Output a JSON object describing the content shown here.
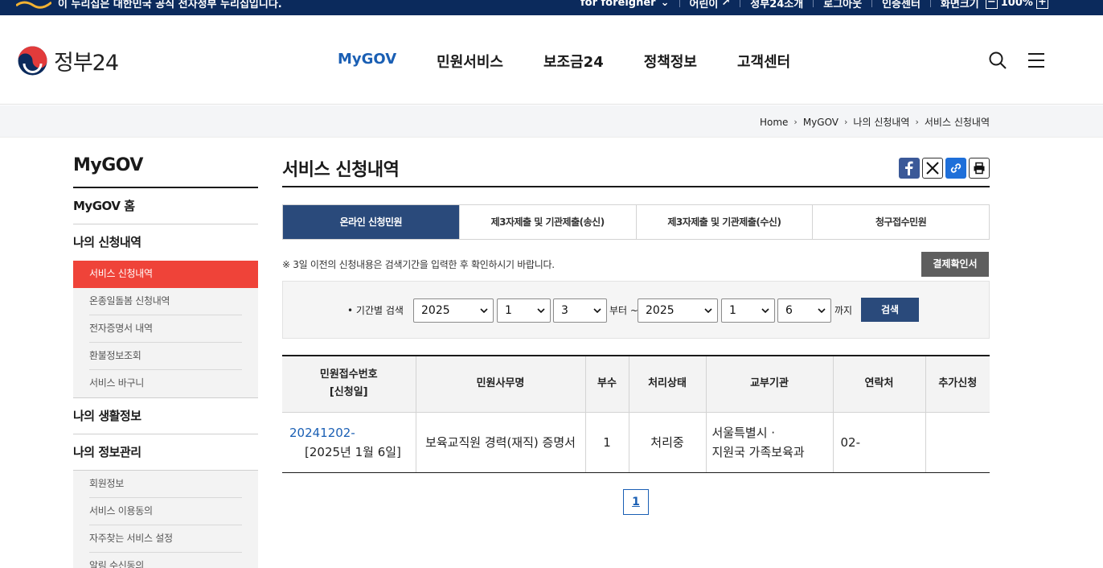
{
  "topbar": {
    "notice": "이 누리집은 대한민국 공식 전자정부 누리집입니다.",
    "links": [
      "for foreigner",
      "어린이",
      "정부24소개",
      "로그아웃",
      "인증센터",
      "화면크기"
    ],
    "zoom_minus": "−",
    "zoom_value": "100%",
    "zoom_plus": "+"
  },
  "header": {
    "logo_text": "정부24",
    "nav": [
      "MyGOV",
      "민원서비스",
      "보조금24",
      "정책정보",
      "고객센터"
    ],
    "active_nav": "MyGOV"
  },
  "breadcrumb": [
    "Home",
    "MyGOV",
    "나의 신청내역",
    "서비스 신청내역"
  ],
  "sidebar": {
    "title": "MyGOV",
    "groups": [
      {
        "label": "MyGOV 홈"
      },
      {
        "label": "나의 신청내역",
        "items": [
          "서비스 신청내역",
          "온종일돌봄 신청내역",
          "전자증명서 내역",
          "환불정보조회",
          "서비스 바구니"
        ]
      },
      {
        "label": "나의 생활정보"
      },
      {
        "label": "나의 정보관리",
        "items": [
          "회원정보",
          "서비스 이용동의",
          "자주찾는 서비스 설정",
          "알림 수신동의"
        ]
      }
    ],
    "active_item": "서비스 신청내역"
  },
  "main": {
    "title": "서비스 신청내역",
    "tabs": [
      "온라인 신청민원",
      "제3자제출 및 기관제출(송신)",
      "제3자제출 및 기관제출(수신)",
      "청구접수민원"
    ],
    "active_tab": "온라인 신청민원",
    "notice": "※ 3일 이전의 신청내용은 검색기간을 입력한 후 확인하시기 바랍니다.",
    "receipt_button": "결제확인서",
    "search": {
      "label": "기간별 검색",
      "from_year": "2025",
      "from_month": "1",
      "from_day": "3",
      "from_text": "부터 ~",
      "to_year": "2025",
      "to_month": "1",
      "to_day": "6",
      "to_text": "까지",
      "button": "검색"
    },
    "table": {
      "headers": [
        "민원접수번호",
        "[신청일]",
        "민원사무명",
        "부수",
        "처리상태",
        "교부기관",
        "연락처",
        "추가신청"
      ],
      "rows": [
        {
          "receipt_no": "20241202-",
          "apply_date": "[2025년 1월 6일]",
          "service": "보육교직원 경력(재직) 증명서",
          "copies": "1",
          "status": "처리중",
          "agency_line1": "서울특별시 ·",
          "agency_line2": "지원국 가족보육과",
          "contact": "02-",
          "extra": ""
        }
      ]
    },
    "pagination": [
      "1"
    ]
  },
  "colors": {
    "navy": "#0b2a5c",
    "tab_active": "#2a4a7b",
    "sidebar_active": "#ef4339",
    "link": "#1a5fb4"
  }
}
